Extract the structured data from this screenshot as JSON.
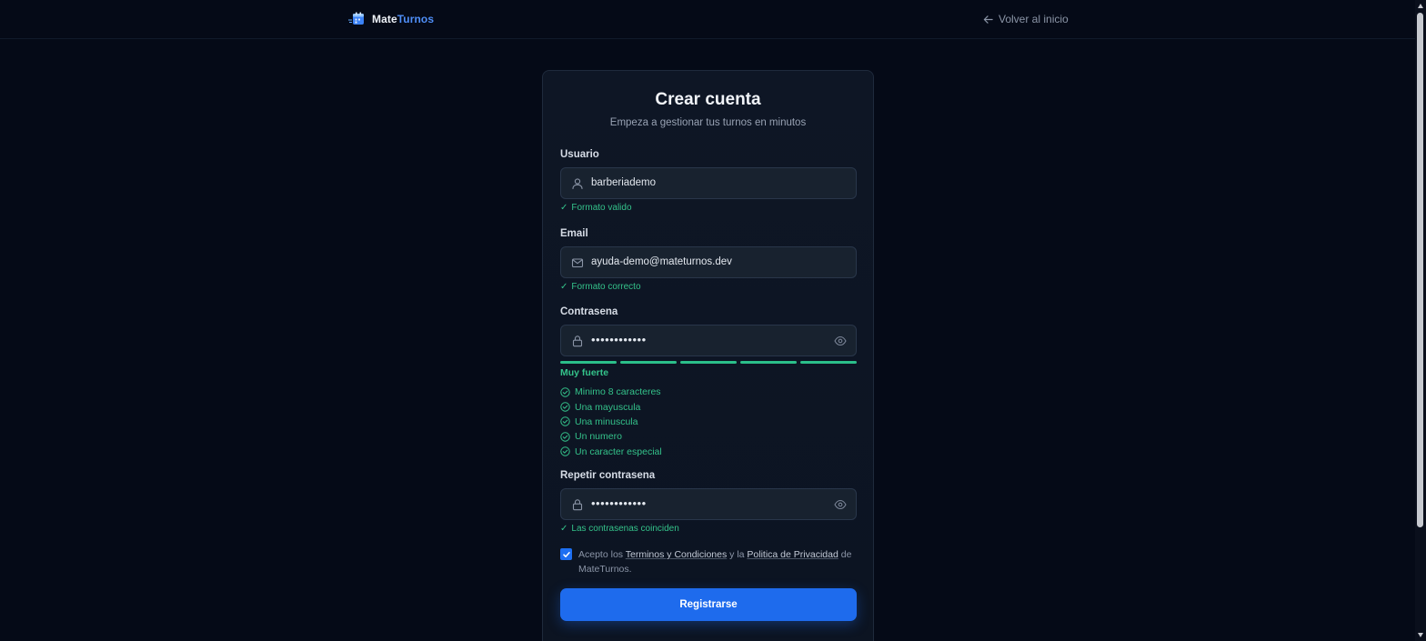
{
  "header": {
    "brand_mate": "Mate",
    "brand_turnos": "Turnos",
    "back_label": "Volver al inicio"
  },
  "card": {
    "title": "Crear cuenta",
    "subtitle": "Empeza a gestionar tus turnos en minutos"
  },
  "form": {
    "username": {
      "label": "Usuario",
      "value": "barberiademo",
      "hint": "Formato valido"
    },
    "email": {
      "label": "Email",
      "value": "ayuda-demo@mateturnos.dev",
      "hint": "Formato correcto"
    },
    "password": {
      "label": "Contrasena",
      "value": "••••••••••••",
      "strength_label": "Muy fuerte",
      "strength_level": 5,
      "strength_max": 5,
      "requirements": [
        "Minimo 8 caracteres",
        "Una mayuscula",
        "Una minuscula",
        "Un numero",
        "Un caracter especial"
      ]
    },
    "confirm": {
      "label": "Repetir contrasena",
      "value": "••••••••••••",
      "hint": "Las contrasenas coinciden"
    },
    "terms": {
      "checked": true,
      "prefix": "Acepto los ",
      "terms_link": "Terminos y Condiciones",
      "middle": " y la ",
      "privacy_link": "Politica de Privacidad",
      "suffix": " de MateTurnos."
    },
    "submit_label": "Registrarse"
  },
  "colors": {
    "accent": "#1e6bed",
    "success": "#34c28a",
    "background": "#050a17"
  }
}
